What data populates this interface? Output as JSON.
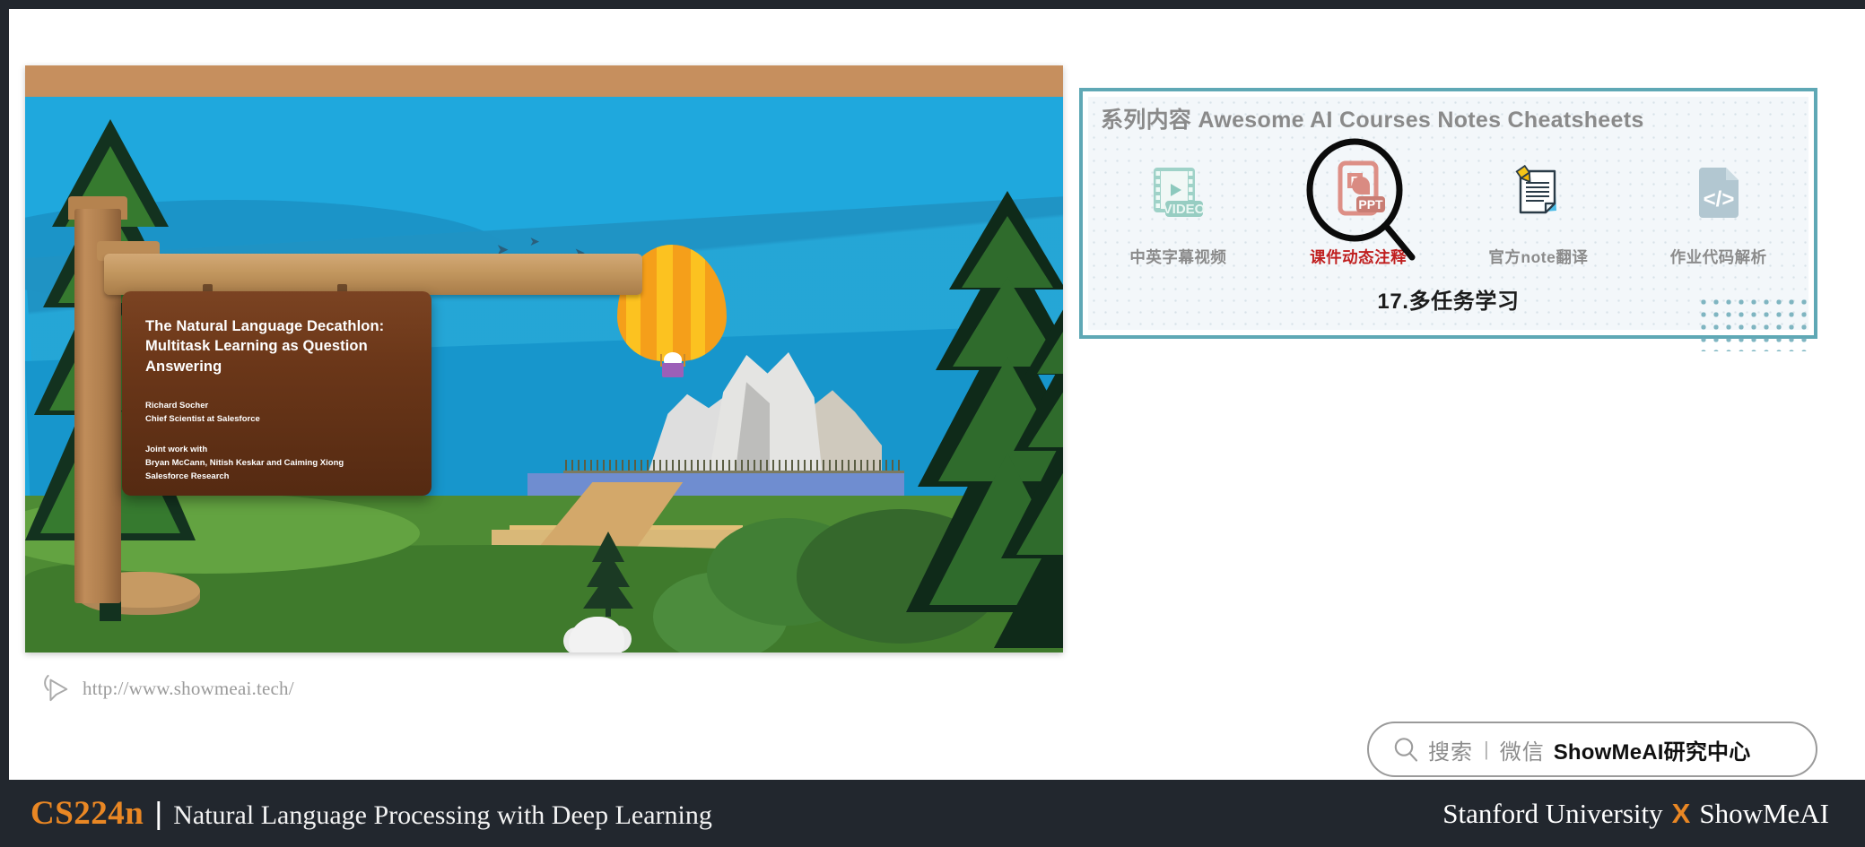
{
  "slide": {
    "title": "The Natural Language Decathlon: Multitask Learning as Question Answering",
    "author_name": "Richard Socher",
    "author_role": "Chief Scientist at Salesforce",
    "joint_label": "Joint work with",
    "joint_authors": "Bryan McCann, Nitish Keskar and Caiming Xiong",
    "joint_org": "Salesforce Research"
  },
  "url_bar": {
    "icon": "cursor-arrow-icon",
    "text": "http://www.showmeai.tech/"
  },
  "panel": {
    "title": "系列内容 Awesome AI Courses Notes Cheatsheets",
    "border_color": "#5fa8b5",
    "items": [
      {
        "icon": "video-film-icon",
        "badge": "VIDEO",
        "label": "中英字幕视频",
        "active": false
      },
      {
        "icon": "ppt-file-icon",
        "badge": "PPT",
        "letter": "P",
        "label": "课件动态注释",
        "active": true,
        "highlight_color": "#c02020"
      },
      {
        "icon": "note-page-icon",
        "label": "官方note翻译",
        "active": false
      },
      {
        "icon": "code-file-icon",
        "badge": "</>",
        "label": "作业代码解析",
        "active": false
      }
    ],
    "chapter": "17.多任务学习"
  },
  "search": {
    "icon": "search-magnifier-icon",
    "prefix": "搜索",
    "separator": "|",
    "channel": "微信",
    "brand": "ShowMeAI研究中心"
  },
  "footer": {
    "course_code": "CS224n",
    "divider": "|",
    "course_name": "Natural Language Processing with Deep Learning",
    "university": "Stanford University",
    "cross": "X",
    "partner": "ShowMeAI",
    "accent_color": "#e98724",
    "background_color": "#22272e"
  }
}
